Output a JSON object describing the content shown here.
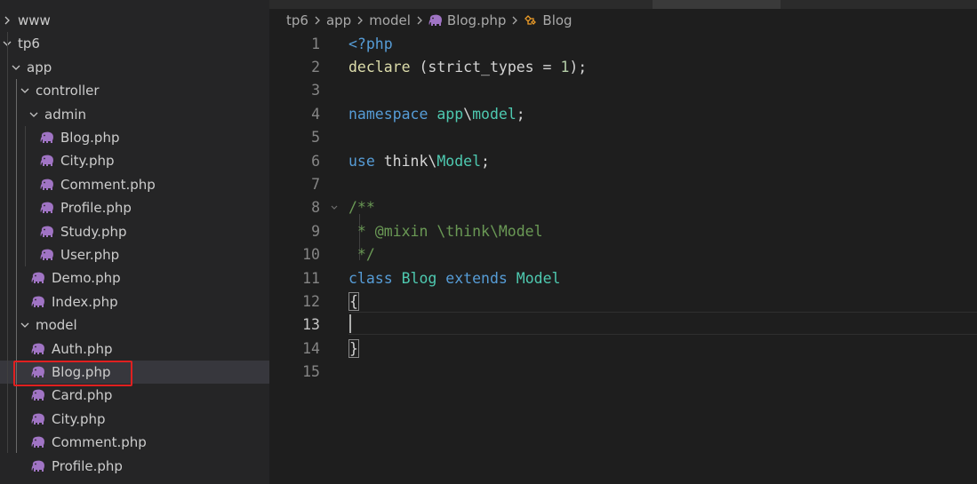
{
  "explorer": {
    "items": [
      {
        "label": "www",
        "kind": "folder",
        "expanded": false,
        "depth": 0
      },
      {
        "label": "tp6",
        "kind": "folder",
        "expanded": true,
        "depth": 0
      },
      {
        "label": "app",
        "kind": "folder",
        "expanded": true,
        "depth": 1
      },
      {
        "label": "controller",
        "kind": "folder",
        "expanded": true,
        "depth": 2
      },
      {
        "label": "admin",
        "kind": "folder",
        "expanded": true,
        "depth": 3
      },
      {
        "label": "Blog.php",
        "kind": "php",
        "depth": 4
      },
      {
        "label": "City.php",
        "kind": "php",
        "depth": 4
      },
      {
        "label": "Comment.php",
        "kind": "php",
        "depth": 4
      },
      {
        "label": "Profile.php",
        "kind": "php",
        "depth": 4
      },
      {
        "label": "Study.php",
        "kind": "php",
        "depth": 4
      },
      {
        "label": "User.php",
        "kind": "php",
        "depth": 4
      },
      {
        "label": "Demo.php",
        "kind": "php",
        "depth": 3
      },
      {
        "label": "Index.php",
        "kind": "php",
        "depth": 3
      },
      {
        "label": "model",
        "kind": "folder",
        "expanded": true,
        "depth": 2
      },
      {
        "label": "Auth.php",
        "kind": "php",
        "depth": 3
      },
      {
        "label": "Blog.php",
        "kind": "php",
        "depth": 3,
        "selected": true,
        "highlighted": true
      },
      {
        "label": "Card.php",
        "kind": "php",
        "depth": 3
      },
      {
        "label": "City.php",
        "kind": "php",
        "depth": 3
      },
      {
        "label": "Comment.php",
        "kind": "php",
        "depth": 3
      },
      {
        "label": "Profile.php",
        "kind": "php",
        "depth": 3
      }
    ]
  },
  "breadcrumb": {
    "segments": [
      "tp6",
      "app",
      "model",
      "Blog.php",
      "Blog"
    ],
    "icons": [
      "",
      "",
      "",
      "php-elephant-icon",
      "class-symbol-icon"
    ]
  },
  "editor": {
    "active_line": 13,
    "lines": [
      {
        "num": "1",
        "tokens": [
          [
            "kw",
            "<?php"
          ]
        ]
      },
      {
        "num": "2",
        "tokens": [
          [
            "fn",
            "declare"
          ],
          [
            "tx",
            " (strict_types = "
          ],
          [
            "num",
            "1"
          ],
          [
            "tx",
            ");"
          ]
        ]
      },
      {
        "num": "3",
        "tokens": []
      },
      {
        "num": "4",
        "tokens": [
          [
            "kw",
            "namespace"
          ],
          [
            "tx",
            " "
          ],
          [
            "cls",
            "app"
          ],
          [
            "tx",
            "\\"
          ],
          [
            "cls",
            "model"
          ],
          [
            "tx",
            ";"
          ]
        ]
      },
      {
        "num": "5",
        "tokens": []
      },
      {
        "num": "6",
        "tokens": [
          [
            "kw",
            "use"
          ],
          [
            "tx",
            " think\\"
          ],
          [
            "cls",
            "Model"
          ],
          [
            "tx",
            ";"
          ]
        ]
      },
      {
        "num": "7",
        "tokens": []
      },
      {
        "num": "8",
        "tokens": [
          [
            "cm",
            "/**"
          ]
        ],
        "fold": true
      },
      {
        "num": "9",
        "tokens": [
          [
            "cm",
            " * @mixin \\think\\Model"
          ]
        ]
      },
      {
        "num": "10",
        "tokens": [
          [
            "cm",
            " */"
          ]
        ]
      },
      {
        "num": "11",
        "tokens": [
          [
            "kw",
            "class"
          ],
          [
            "tx",
            " "
          ],
          [
            "cls",
            "Blog"
          ],
          [
            "tx",
            " "
          ],
          [
            "kw",
            "extends"
          ],
          [
            "tx",
            " "
          ],
          [
            "cls",
            "Model"
          ]
        ]
      },
      {
        "num": "12",
        "tokens": [
          [
            "bracket",
            "{"
          ]
        ]
      },
      {
        "num": "13",
        "tokens": []
      },
      {
        "num": "14",
        "tokens": [
          [
            "bracket",
            "}"
          ]
        ]
      },
      {
        "num": "15",
        "tokens": []
      }
    ]
  },
  "colors": {
    "keyword": "#569cd6",
    "function": "#dcdcaa",
    "class": "#4ec9b0",
    "number": "#b5cea8",
    "comment": "#6a9955",
    "text": "#d4d4d4",
    "highlight_box": "#e02020",
    "php_icon": "#a074c4"
  }
}
